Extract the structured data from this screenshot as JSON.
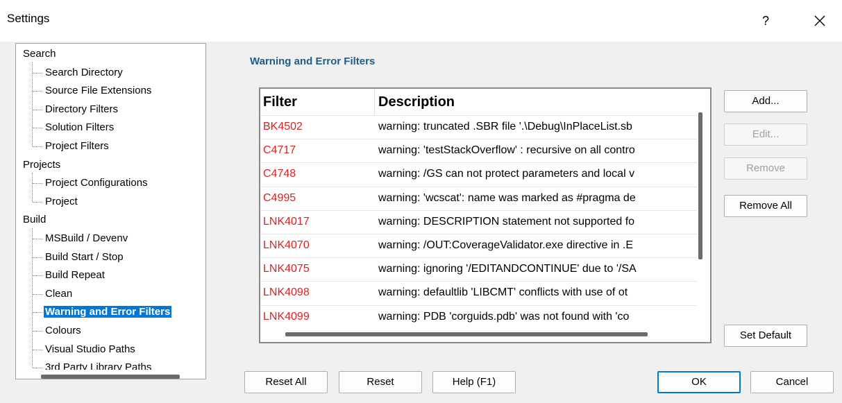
{
  "window": {
    "title": "Settings",
    "help_label": "?"
  },
  "tree": {
    "items": [
      {
        "label": "Search",
        "kind": "category"
      },
      {
        "label": "Search Directory",
        "kind": "child"
      },
      {
        "label": "Source File Extensions",
        "kind": "child"
      },
      {
        "label": "Directory Filters",
        "kind": "child"
      },
      {
        "label": "Solution Filters",
        "kind": "child"
      },
      {
        "label": "Project Filters",
        "kind": "child"
      },
      {
        "label": "Projects",
        "kind": "category"
      },
      {
        "label": "Project Configurations",
        "kind": "child"
      },
      {
        "label": "Project",
        "kind": "child"
      },
      {
        "label": "Build",
        "kind": "category"
      },
      {
        "label": "MSBuild / Devenv",
        "kind": "child"
      },
      {
        "label": "Build Start / Stop",
        "kind": "child"
      },
      {
        "label": "Build Repeat",
        "kind": "child"
      },
      {
        "label": "Clean",
        "kind": "child"
      },
      {
        "label": "Warning and Error Filters",
        "kind": "child",
        "selected": true
      },
      {
        "label": "Colours",
        "kind": "child"
      },
      {
        "label": "Visual Studio Paths",
        "kind": "child"
      },
      {
        "label": "3rd Party Library Paths",
        "kind": "child"
      }
    ]
  },
  "panel": {
    "title": "Warning and Error Filters"
  },
  "table": {
    "headers": {
      "filter": "Filter",
      "description": "Description"
    },
    "rows": [
      {
        "filter": "BK4502",
        "description": "warning: truncated .SBR file '.\\Debug\\InPlaceList.sb"
      },
      {
        "filter": "C4717",
        "description": "warning: 'testStackOverflow' : recursive on all contro"
      },
      {
        "filter": "C4748",
        "description": "warning: /GS can not protect parameters and local v"
      },
      {
        "filter": "C4995",
        "description": "warning: 'wcscat': name was marked as #pragma de"
      },
      {
        "filter": "LNK4017",
        "description": "warning: DESCRIPTION statement not supported fo"
      },
      {
        "filter": "LNK4070",
        "description": "warning: /OUT:CoverageValidator.exe directive in .E"
      },
      {
        "filter": "LNK4075",
        "description": "warning: ignoring '/EDITANDCONTINUE' due to '/SA"
      },
      {
        "filter": "LNK4098",
        "description": "warning: defaultlib 'LIBCMT' conflicts with use of ot"
      },
      {
        "filter": "LNK4099",
        "description": "warning: PDB 'corguids.pdb' was not found with 'co"
      }
    ]
  },
  "buttons": {
    "add": "Add...",
    "edit": "Edit...",
    "remove": "Remove",
    "remove_all": "Remove All",
    "set_default": "Set Default",
    "reset_all": "Reset All",
    "reset": "Reset",
    "help": "Help (F1)",
    "ok": "OK",
    "cancel": "Cancel"
  },
  "colors": {
    "accent": "#0078d7",
    "filter_code": "#e02020",
    "panel_title": "#1f5c86"
  }
}
